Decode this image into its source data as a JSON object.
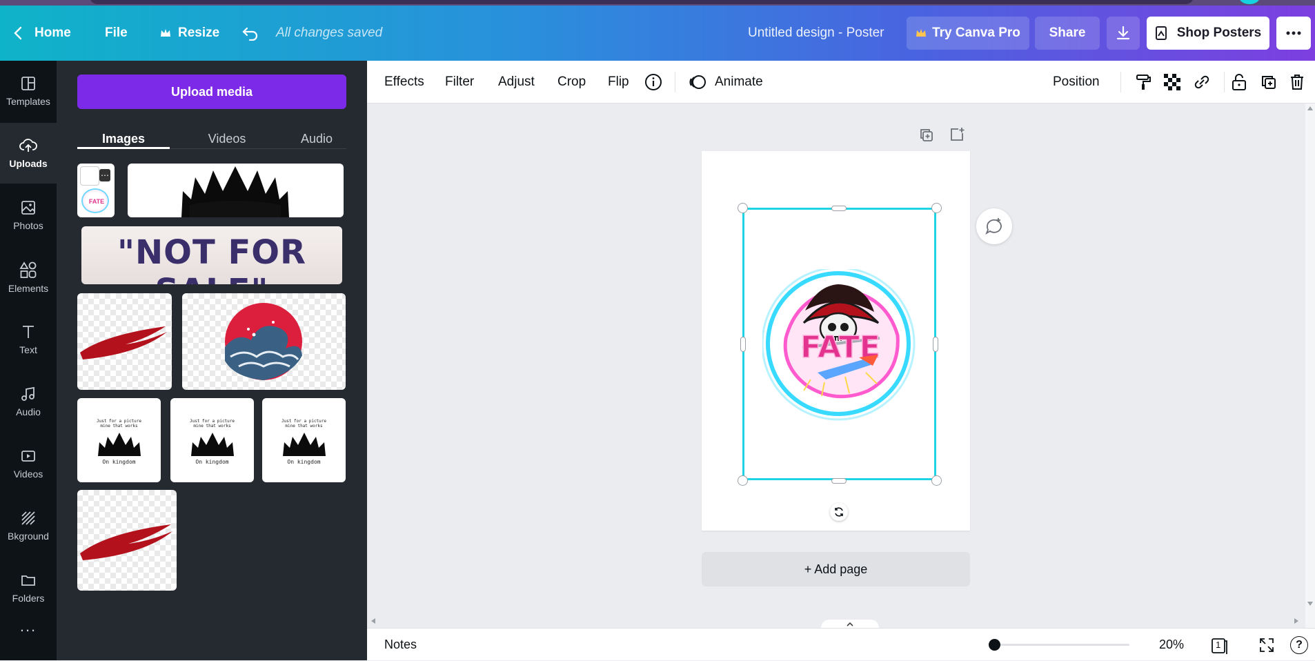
{
  "topbar": {
    "home": "Home",
    "file": "File",
    "resize": "Resize",
    "saved": "All changes saved",
    "design_title": "Untitled design - Poster",
    "try_pro": "Try Canva Pro",
    "share": "Share",
    "shop": "Shop Posters"
  },
  "rail": {
    "items": [
      {
        "label": "Templates",
        "icon": "templates-icon"
      },
      {
        "label": "Uploads",
        "icon": "upload-cloud-icon"
      },
      {
        "label": "Photos",
        "icon": "photos-icon"
      },
      {
        "label": "Elements",
        "icon": "elements-icon"
      },
      {
        "label": "Text",
        "icon": "text-icon"
      },
      {
        "label": "Audio",
        "icon": "audio-icon"
      },
      {
        "label": "Videos",
        "icon": "videos-icon"
      },
      {
        "label": "Bkground",
        "icon": "background-icon"
      },
      {
        "label": "Folders",
        "icon": "folder-icon"
      }
    ],
    "more": "..."
  },
  "panel": {
    "upload_button": "Upload media",
    "tabs": [
      "Images",
      "Videos",
      "Audio"
    ],
    "thumbs": {
      "not_for_sale": "\"NOT FOR SALE\"",
      "kingdom_top": "Just for a picture\nmine that works",
      "kingdom_bottom": "On kingdom",
      "fate": "FATE"
    }
  },
  "toolbar": {
    "effects": "Effects",
    "filter": "Filter",
    "adjust": "Adjust",
    "crop": "Crop",
    "flip": "Flip",
    "animate": "Animate",
    "position": "Position"
  },
  "canvas": {
    "add_page": "+ Add page",
    "design_text": "FATE"
  },
  "footer": {
    "notes": "Notes",
    "zoom": "20%",
    "page_count": "1",
    "zoom_level": 0.02,
    "help": "?"
  },
  "colors": {
    "accent_purple": "#7d2ae8",
    "selection": "#1ed4e5",
    "rail_bg": "#0e1318",
    "panel_bg": "#252a31"
  }
}
